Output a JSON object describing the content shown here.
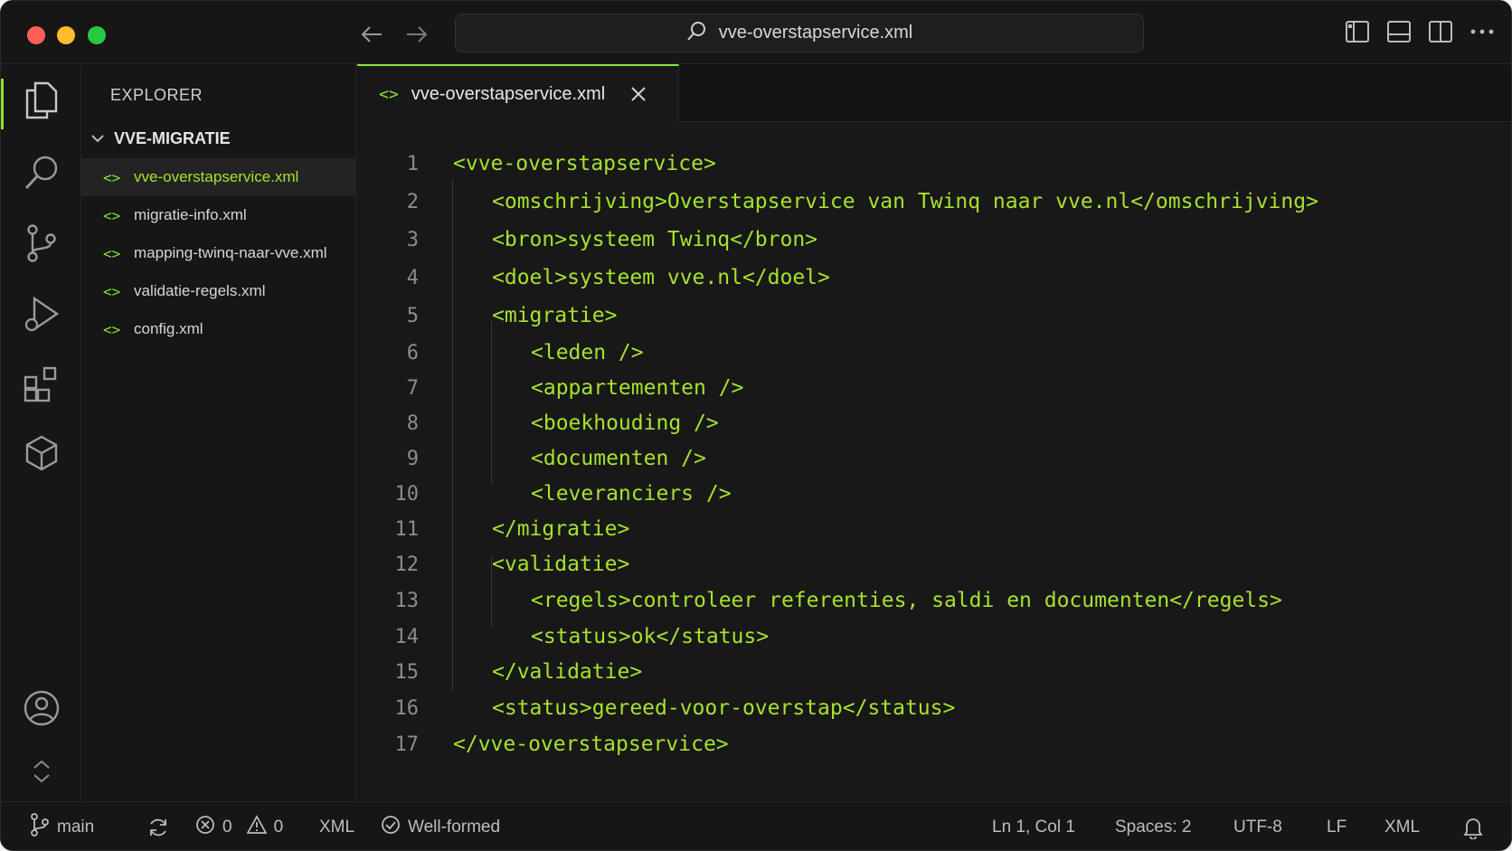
{
  "titlebar": {
    "search_text": "vve-overstapservice.xml"
  },
  "sidebar": {
    "title": "EXPLORER",
    "folder": "VVE-MIGRATIE",
    "files": [
      {
        "name": "vve-overstapservice.xml",
        "icon": "<>"
      },
      {
        "name": "migratie-info.xml",
        "icon": "<>"
      },
      {
        "name": "mapping-twinq-naar-vve.xml",
        "icon": "<>"
      },
      {
        "name": "validatie-regels.xml",
        "icon": "<>"
      },
      {
        "name": "config.xml",
        "icon": "<>"
      }
    ]
  },
  "editor": {
    "tab_label": "vve-overstapservice.xml",
    "tab_icon": "<>",
    "lines": [
      {
        "n": "1",
        "text": "<vve-overstapservice>"
      },
      {
        "n": "2",
        "text": "<omschrijving>Overstapservice van Twinq naar vve.nl</omschrijving>"
      },
      {
        "n": "3",
        "text": "<bron>systeem Twinq</bron>"
      },
      {
        "n": "4",
        "text": "<doel>systeem vve.nl</doel>"
      },
      {
        "n": "5",
        "text": "<migratie>"
      },
      {
        "n": "6",
        "text": "<leden />"
      },
      {
        "n": "7",
        "text": "<appartementen />"
      },
      {
        "n": "8",
        "text": "<boekhouding />"
      },
      {
        "n": "9",
        "text": "<documenten />"
      },
      {
        "n": "10",
        "text": "<leveranciers />"
      },
      {
        "n": "11",
        "text": "</migratie>"
      },
      {
        "n": "12",
        "text": "<validatie>"
      },
      {
        "n": "13",
        "text": "<regels>controleer referenties, saldi en documenten</regels>"
      },
      {
        "n": "14",
        "text": "<status>ok</status>"
      },
      {
        "n": "15",
        "text": "</validatie>"
      },
      {
        "n": "16",
        "text": "<status>gereed-voor-overstap</status>"
      },
      {
        "n": "17",
        "text": "</vve-overstapservice>"
      }
    ]
  },
  "statusbar": {
    "branch": "main",
    "errors": "0",
    "warnings": "0",
    "language_left": "XML",
    "wellformed": "Well-formed",
    "position": "Ln 1, Col 1",
    "spaces": "Spaces: 2",
    "encoding": "UTF-8",
    "eol": "LF",
    "language": "XML"
  },
  "colors": {
    "accent": "#8ae234",
    "code": "#a6e22e",
    "background": "#181818"
  }
}
